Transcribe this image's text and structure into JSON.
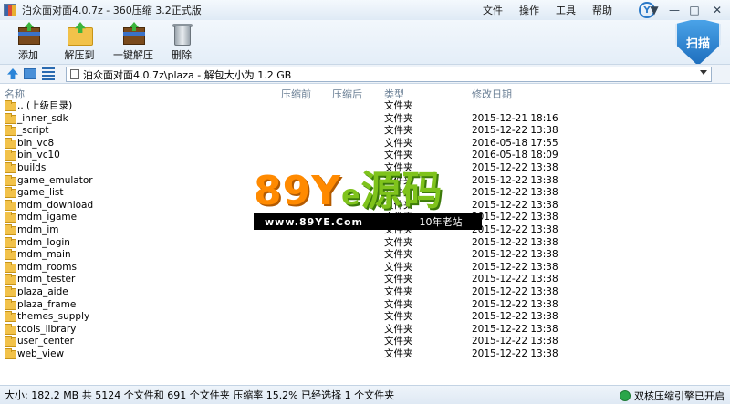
{
  "window": {
    "title": "泊众面对面4.0.7z - 360压缩 3.2正式版"
  },
  "menu": [
    "文件",
    "操作",
    "工具",
    "帮助"
  ],
  "toolbar": {
    "add_label": "添加",
    "extract_label": "解压到",
    "one_click_label": "一键解压",
    "delete_label": "删除",
    "scan_label": "扫描"
  },
  "address": {
    "path": "泊众面对面4.0.7z\\plaza - 解包大小为 1.2 GB"
  },
  "columns": {
    "name": "名称",
    "compressed": "压缩前",
    "after": "压缩后",
    "type": "类型",
    "modified": "修改日期"
  },
  "files": [
    {
      "name": ".. (上级目录)",
      "type": "文件夹",
      "date": ""
    },
    {
      "name": "_inner_sdk",
      "type": "文件夹",
      "date": "2015-12-21 18:16"
    },
    {
      "name": "_script",
      "type": "文件夹",
      "date": "2015-12-22 13:38"
    },
    {
      "name": "bin_vc8",
      "type": "文件夹",
      "date": "2016-05-18 17:55"
    },
    {
      "name": "bin_vc10",
      "type": "文件夹",
      "date": "2016-05-18 18:09"
    },
    {
      "name": "builds",
      "type": "文件夹",
      "date": "2015-12-22 13:38"
    },
    {
      "name": "game_emulator",
      "type": "文件夹",
      "date": "2015-12-22 13:38"
    },
    {
      "name": "game_list",
      "type": "文件夹",
      "date": "2015-12-22 13:38"
    },
    {
      "name": "mdm_download",
      "type": "文件夹",
      "date": "2015-12-22 13:38"
    },
    {
      "name": "mdm_igame",
      "type": "文件夹",
      "date": "2015-12-22 13:38"
    },
    {
      "name": "mdm_im",
      "type": "文件夹",
      "date": "2015-12-22 13:38"
    },
    {
      "name": "mdm_login",
      "type": "文件夹",
      "date": "2015-12-22 13:38"
    },
    {
      "name": "mdm_main",
      "type": "文件夹",
      "date": "2015-12-22 13:38"
    },
    {
      "name": "mdm_rooms",
      "type": "文件夹",
      "date": "2015-12-22 13:38"
    },
    {
      "name": "mdm_tester",
      "type": "文件夹",
      "date": "2015-12-22 13:38"
    },
    {
      "name": "plaza_aide",
      "type": "文件夹",
      "date": "2015-12-22 13:38"
    },
    {
      "name": "plaza_frame",
      "type": "文件夹",
      "date": "2015-12-22 13:38"
    },
    {
      "name": "themes_supply",
      "type": "文件夹",
      "date": "2015-12-22 13:38"
    },
    {
      "name": "tools_library",
      "type": "文件夹",
      "date": "2015-12-22 13:38"
    },
    {
      "name": "user_center",
      "type": "文件夹",
      "date": "2015-12-22 13:38"
    },
    {
      "name": "web_view",
      "type": "文件夹",
      "date": "2015-12-22 13:38"
    }
  ],
  "watermark": {
    "num": "89",
    "y": "Y",
    "e": "e",
    "cn": "源码",
    "url": "www.89YE.Com",
    "tag": "10年老站"
  },
  "status": {
    "text": "大小: 182.2 MB 共 5124 个文件和 691 个文件夹 压缩率 15.2% 已经选择 1 个文件夹",
    "right": "双核压缩引擎已开启"
  }
}
